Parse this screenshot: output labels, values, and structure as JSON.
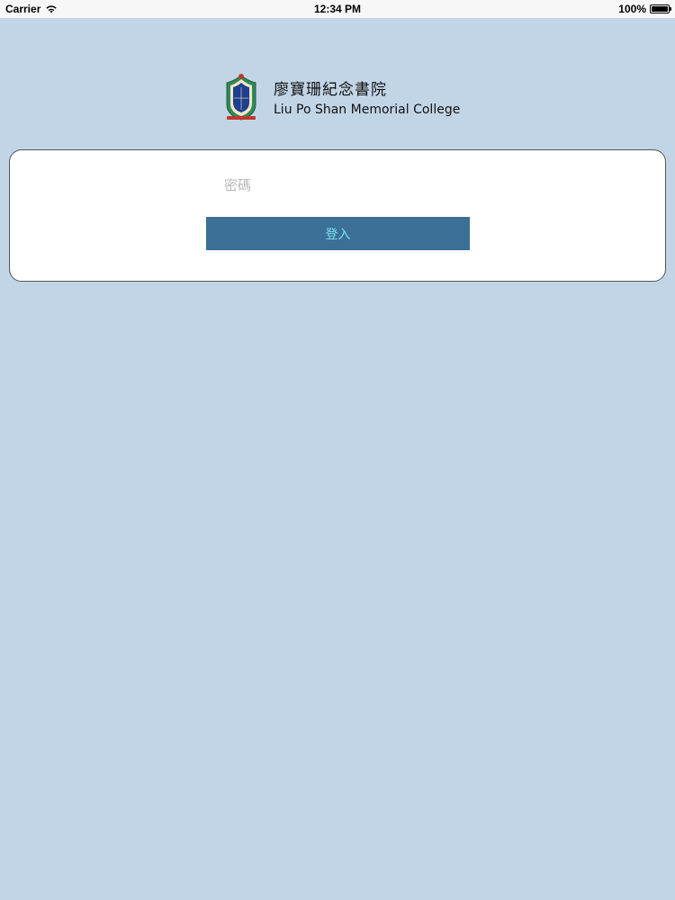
{
  "status_bar": {
    "carrier": "Carrier",
    "time": "12:34 PM",
    "battery_percent": "100%",
    "icons": [
      "wifi-icon",
      "battery-icon"
    ]
  },
  "header": {
    "name_cn": "廖寶珊紀念書院",
    "name_en": "Liu Po Shan Memorial College",
    "crest_icon": "school-crest-icon",
    "crest_text": "興創仁業"
  },
  "login": {
    "password_placeholder": "密碼",
    "password_value": "",
    "submit_label": "登入"
  },
  "colors": {
    "background": "#c2d5e7",
    "button": "#3b6f96",
    "button_text": "#7fe0f0",
    "card": "#ffffff"
  }
}
